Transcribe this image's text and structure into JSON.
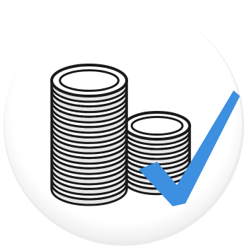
{
  "icon": {
    "name": "coin-stacks-checkmark-icon",
    "background_color": "#ffffff",
    "circle_fill": "#ffffff",
    "circle_shadow": "#d6d6d6",
    "coin_stroke": "#1a1a1a",
    "coin_fill": "#ffffff",
    "coin_shade": "#e6e6e6",
    "check_color": "#3d8fe0",
    "tall_stack_coin_count": 11,
    "short_stack_coin_count": 6
  }
}
